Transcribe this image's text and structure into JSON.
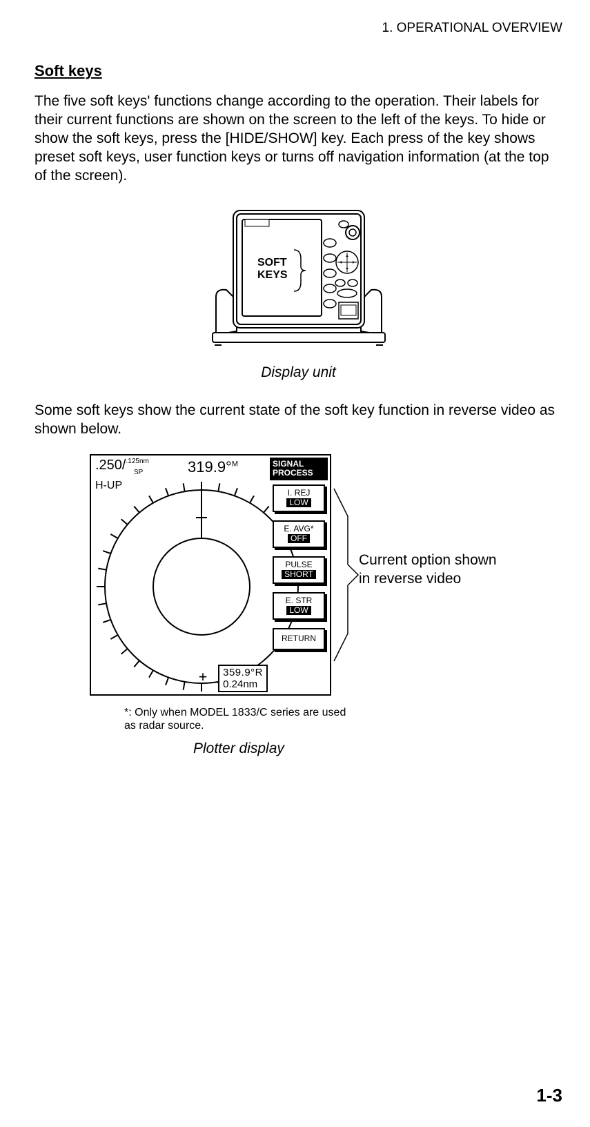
{
  "chapter": "1. OPERATIONAL OVERVIEW",
  "section_title": "Soft keys",
  "para1": "The five soft keys' functions change according to the operation. Their labels for their current functions are shown on the screen to the left of the keys. To hide or show the soft keys, press the [HIDE/SHOW] key. Each press of the key shows preset soft keys, user function keys or turns off navigation information (at the top of the screen).",
  "display_unit": {
    "label": "SOFT\nKEYS",
    "caption": "Display unit"
  },
  "para2": "Some soft keys show the current state of the soft key function in reverse video as shown below.",
  "plotter": {
    "range_main": ".250/",
    "range_sub_top": ".125nm",
    "range_sub_bottom": "SP",
    "mode": "H-UP",
    "heading": "319.9°",
    "heading_suffix": "M",
    "panel_title": "SIGNAL PROCESS",
    "softkeys": [
      {
        "label": "I.  REJ",
        "value": "LOW"
      },
      {
        "label": "E. AVG*",
        "value": "OFF"
      },
      {
        "label": "PULSE",
        "value": "SHORT"
      },
      {
        "label": "E. STR",
        "value": "LOW"
      },
      {
        "label": "RETURN",
        "value": ""
      }
    ],
    "bearing": "359.9°R",
    "distance": "0.24nm",
    "annotation": "Current option shown in reverse video",
    "footnote": "*: Only when MODEL 1833/C series are used as radar source.",
    "caption": "Plotter display"
  },
  "page_number": "1-3"
}
